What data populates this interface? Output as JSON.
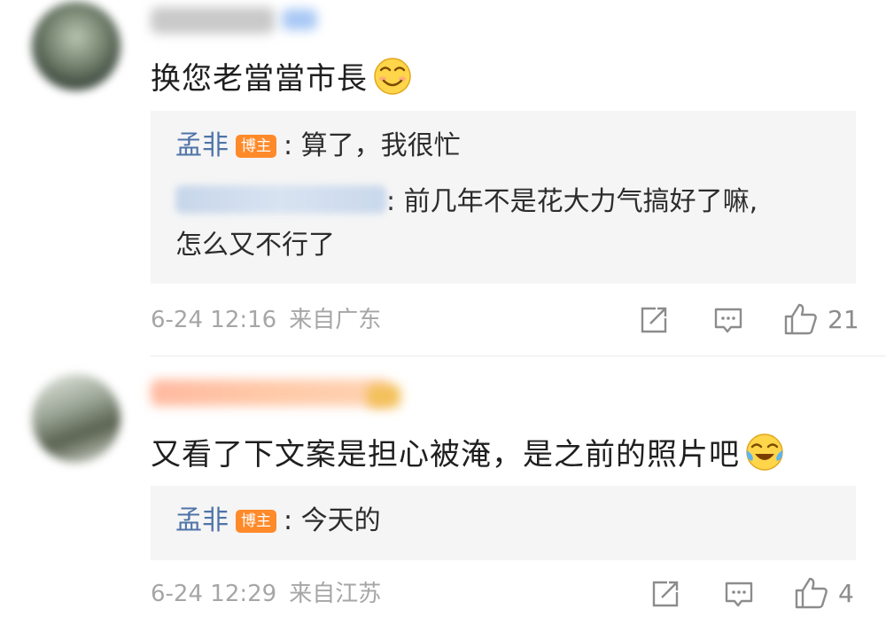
{
  "comments": [
    {
      "text": "换您老當當市長",
      "emoji_icon": "grin-emoji-icon",
      "replies": [
        {
          "author": "孟非",
          "badge": "博主",
          "separator": ":",
          "text": "算了，我很忙"
        },
        {
          "separator": ":",
          "text_line1": "前几年不是花大力气搞好了嘛,",
          "text_line2": "怎么又不行了"
        }
      ],
      "date": "6-24 12:16",
      "location": "来自广东",
      "like_count": "21"
    },
    {
      "text": "又看了下文案是担心被淹，是之前的照片吧",
      "emoji_icon": "laugh-cry-emoji-icon",
      "replies": [
        {
          "author": "孟非",
          "badge": "博主",
          "separator": ":",
          "text": "今天的"
        }
      ],
      "date": "6-24 12:29",
      "location": "来自江苏",
      "like_count": "4"
    }
  ],
  "colors": {
    "author_blue": "#4f74a8",
    "badge_orange": "#ff8a2a",
    "meta_gray": "#a6a6a6",
    "reply_bg": "#f5f5f5"
  }
}
